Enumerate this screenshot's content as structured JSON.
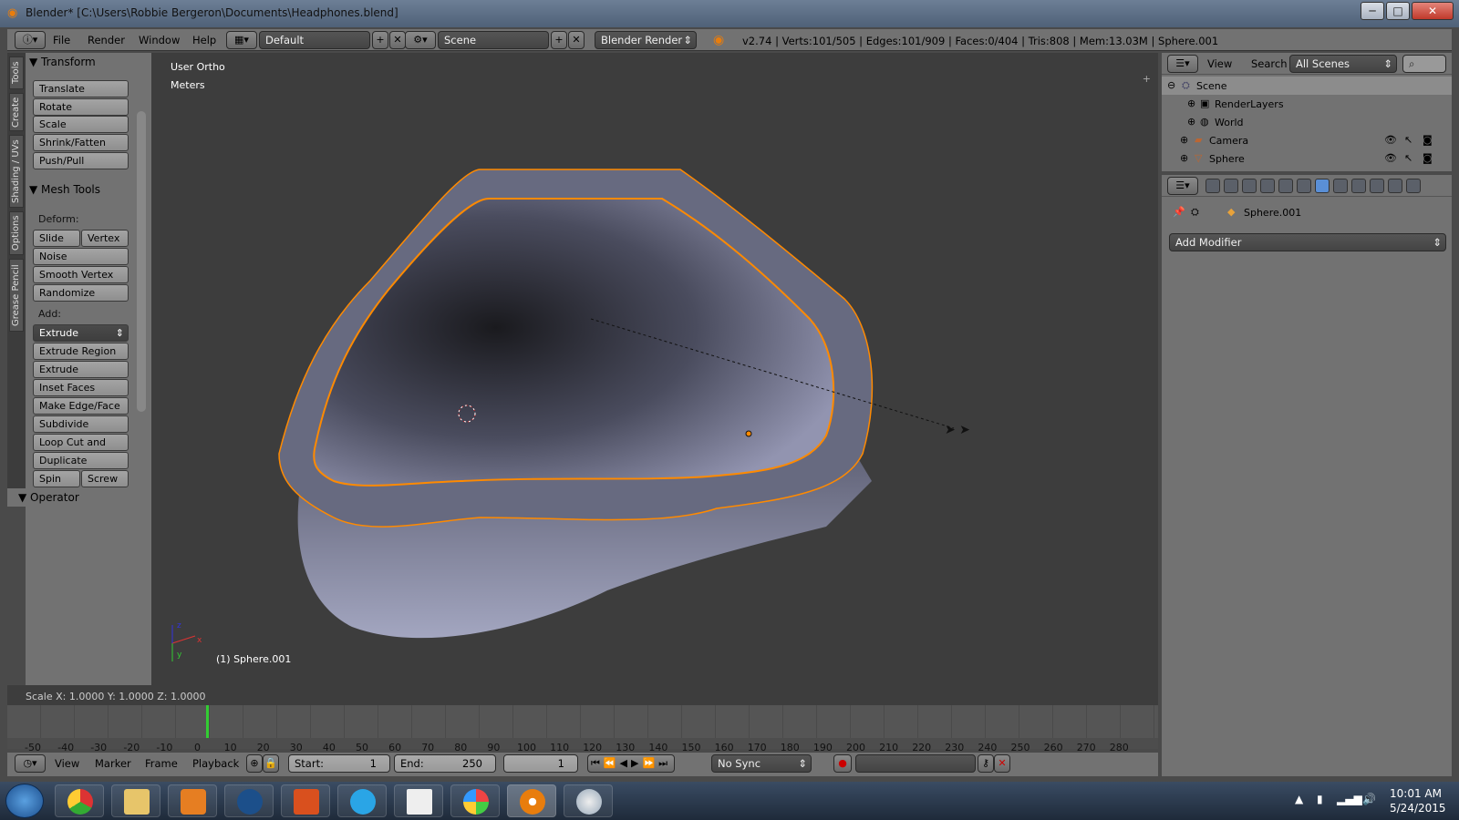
{
  "window": {
    "title": "Blender* [C:\\Users\\Robbie Bergeron\\Documents\\Headphones.blend]",
    "min": "─",
    "max": "□",
    "close": "✕"
  },
  "topbar": {
    "menus": [
      "File",
      "Render",
      "Window",
      "Help"
    ],
    "layout": "Default",
    "scene": "Scene",
    "engine": "Blender Render",
    "stats": "v2.74 | Verts:101/505 | Edges:101/909 | Faces:0/404 | Tris:808 | Mem:13.03M | Sphere.001"
  },
  "tabs": [
    "Tools",
    "Create",
    "Shading / UVs",
    "Options",
    "Grease Pencil"
  ],
  "toolshelf": {
    "transform": {
      "header": "Transform",
      "buttons": [
        "Translate",
        "Rotate",
        "Scale",
        "Shrink/Fatten",
        "Push/Pull"
      ]
    },
    "mesh_tools": {
      "header": "Mesh Tools",
      "deform_label": "Deform:",
      "slide_edge": "Slide Ed",
      "vertex": "Vertex",
      "deform_buttons": [
        "Noise",
        "Smooth Vertex",
        "Randomize"
      ],
      "add_label": "Add:",
      "extrude": "Extrude",
      "add_buttons": [
        "Extrude Region",
        "Extrude Individual",
        "Inset Faces",
        "Make Edge/Face",
        "Subdivide",
        "Loop Cut and Slide",
        "Duplicate"
      ],
      "spin": "Spin",
      "screw": "Screw"
    },
    "operator": {
      "header": "Operator"
    }
  },
  "viewport": {
    "view": "User Ortho",
    "units": "Meters",
    "object": "(1) Sphere.001",
    "axis_x": "x",
    "axis_y": "y",
    "axis_z": "z"
  },
  "opbar": {
    "text": "Scale X: 1.0000   Y: 1.0000  Z: 1.0000"
  },
  "timeline": {
    "ticks": [
      "-50",
      "-40",
      "-30",
      "-20",
      "-10",
      "0",
      "10",
      "20",
      "30",
      "40",
      "50",
      "60",
      "70",
      "80",
      "90",
      "100",
      "110",
      "120",
      "130",
      "140",
      "150",
      "160",
      "170",
      "180",
      "190",
      "200",
      "210",
      "220",
      "230",
      "240",
      "250",
      "260",
      "270",
      "280"
    ],
    "current_frame": 1,
    "menus": [
      "View",
      "Marker",
      "Frame",
      "Playback"
    ],
    "start_label": "Start:",
    "start": "1",
    "end_label": "End:",
    "end": "250",
    "frame": "1",
    "sync": "No Sync"
  },
  "outliner": {
    "menus": [
      "View",
      "Search"
    ],
    "filter": "All Scenes",
    "items": [
      "Scene",
      "RenderLayers",
      "World",
      "Camera",
      "Sphere"
    ]
  },
  "properties": {
    "object": "Sphere.001",
    "add_modifier": "Add Modifier"
  },
  "taskbar": {
    "time": "10:01 AM",
    "date": "5/24/2015"
  },
  "colors": {
    "accent": "#e87d0d",
    "viewport_bg": "#3d3d3d",
    "panel": "#727272",
    "mesh": "#8f92ad",
    "selected": "#ff8a00"
  }
}
